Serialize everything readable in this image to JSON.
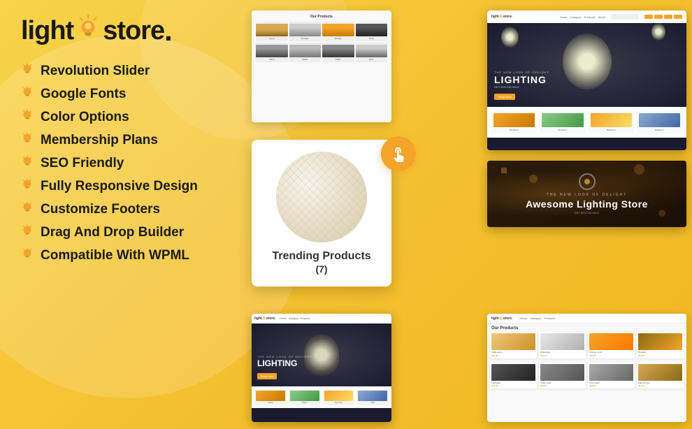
{
  "logo": {
    "text_light": "light",
    "text_store": "store",
    "dot": "."
  },
  "features": [
    {
      "id": "revolution-slider",
      "label": "Revolution Slider"
    },
    {
      "id": "google-fonts",
      "label": "Google Fonts"
    },
    {
      "id": "color-options",
      "label": "Color Options"
    },
    {
      "id": "membership-plans",
      "label": "Membership Plans"
    },
    {
      "id": "seo-friendly",
      "label": "SEO Friendly"
    },
    {
      "id": "fully-responsive",
      "label": "Fully Responsive Design"
    },
    {
      "id": "customize-footers",
      "label": "Customize Footers"
    },
    {
      "id": "drag-drop-builder",
      "label": "Drag And Drop Builder"
    },
    {
      "id": "compatible-wpml",
      "label": "Compatible With WPML"
    }
  ],
  "trending": {
    "label": "Trending Products",
    "count": "(7)"
  },
  "dark_store": {
    "tag": "THE NEW LOOK OF DELIGHT",
    "title": "Awesome Lighting Store",
    "subtitle": "GET 50% ON SALE"
  },
  "hero_section": {
    "pretitle": "THE NEW LOOK OF DELIGHT",
    "title": "LIGHTING",
    "subtitle": "GET 50% ON SALE",
    "cta": "Shop Now"
  },
  "screenshots": {
    "products_title": "Our Products",
    "bottom_grid_title": "Our Products"
  },
  "colors": {
    "yellow": "#f5c030",
    "dark": "#1a1a1a",
    "orange": "#f4a429",
    "hero_bg": "#1a1a2e"
  }
}
